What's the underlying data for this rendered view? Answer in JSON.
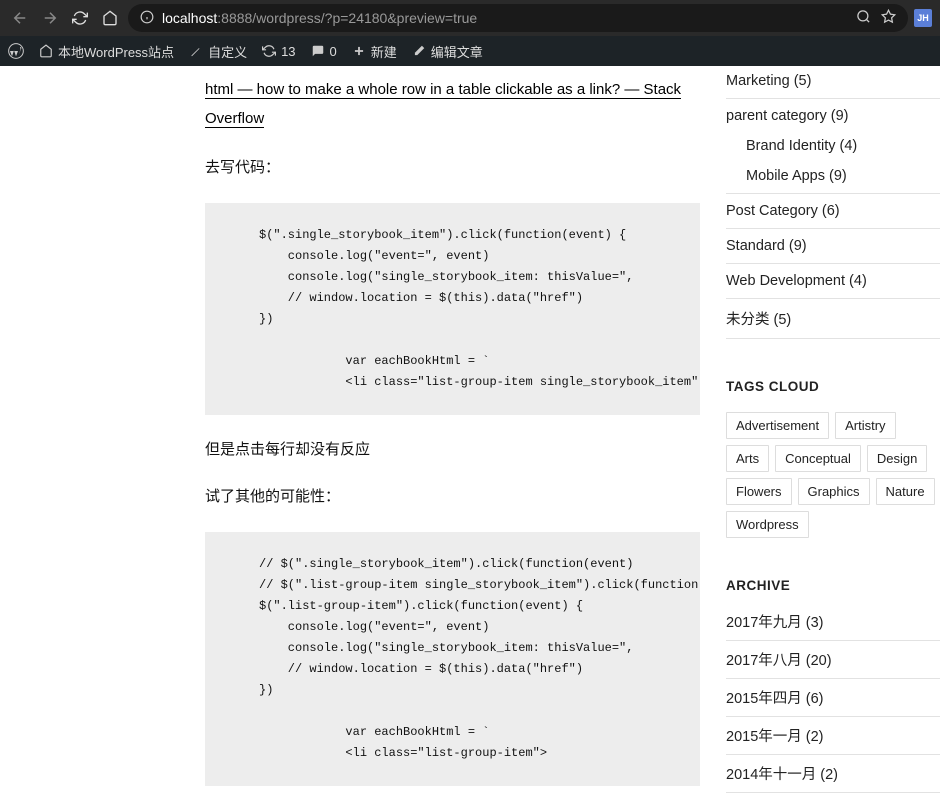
{
  "browser": {
    "url_host": "localhost",
    "url_rest": ":8888/wordpress/?p=24180&preview=true",
    "avatar": "JH"
  },
  "wp_bar": {
    "site_name": "本地WordPress站点",
    "customize": "自定义",
    "updates": "13",
    "comments": "0",
    "new": "新建",
    "edit": "编辑文章"
  },
  "content": {
    "ref_link": "html — how to make a whole row in a table clickable as a link? — Stack Overflow",
    "p1": "去写代码：",
    "code1": "$(\".single_storybook_item\").click(function(event) {\n    console.log(\"event=\", event)\n    console.log(\"single_storybook_item: thisValue=\",\n    // window.location = $(this).data(\"href\")\n})\n\n            var eachBookHtml = `\n            <li class=\"list-group-item single_storybook_item\" data-href=\"...\">",
    "p2": "但是点击每行却没有反应",
    "p3": "试了其他的可能性：",
    "code2": "// $(\".single_storybook_item\").click(function(event)\n// $(\".list-group-item single_storybook_item\").click(function(event)\n$(\".list-group-item\").click(function(event) {\n    console.log(\"event=\", event)\n    console.log(\"single_storybook_item: thisValue=\",\n    // window.location = $(this).data(\"href\")\n})\n\n            var eachBookHtml = `\n            <li class=\"list-group-item\">"
  },
  "categories": [
    {
      "label": "Marketing",
      "count": "(5)",
      "children": []
    },
    {
      "label": "parent category",
      "count": "(9)",
      "children": [
        {
          "label": "Brand Identity",
          "count": "(4)"
        },
        {
          "label": "Mobile Apps",
          "count": "(9)"
        }
      ]
    },
    {
      "label": "Post Category",
      "count": "(6)",
      "children": []
    },
    {
      "label": "Standard",
      "count": "(9)",
      "children": []
    },
    {
      "label": "Web Development",
      "count": "(4)",
      "children": []
    },
    {
      "label": "未分类",
      "count": "(5)",
      "children": []
    }
  ],
  "tags_title": "TAGS CLOUD",
  "tags": [
    "Advertisement",
    "Artistry",
    "Arts",
    "Conceptual",
    "Design",
    "Flowers",
    "Graphics",
    "Nature",
    "Wordpress"
  ],
  "archive_title": "ARCHIVE",
  "archive": [
    {
      "label": "2017年九月",
      "count": "(3)"
    },
    {
      "label": "2017年八月",
      "count": "(20)"
    },
    {
      "label": "2015年四月",
      "count": "(6)"
    },
    {
      "label": "2015年一月",
      "count": "(2)"
    },
    {
      "label": "2014年十一月",
      "count": "(2)"
    }
  ]
}
